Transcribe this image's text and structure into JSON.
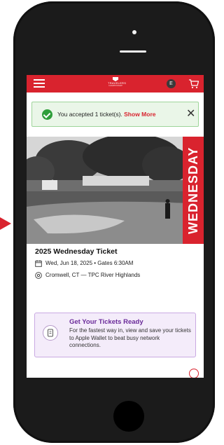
{
  "header": {
    "menu_icon": "hamburger-icon",
    "logo_text": "TRAVELERS",
    "logo_sub": "CHAMPIONSHIP",
    "avatar_text": "E",
    "cart_icon": "cart-icon"
  },
  "alert": {
    "message": "You accepted 1 ticket(s).",
    "show_more": "Show More",
    "close_symbol": "✕"
  },
  "ticket": {
    "day_banner": "WEDNESDAY",
    "title": "2025 Wednesday Ticket",
    "date_line": "Wed, Jun 18, 2025 • Gates 6:30AM",
    "location_line": "Cromwell, CT — TPC River Highlands"
  },
  "wallet_card": {
    "title": "Get Your Tickets Ready",
    "body": "For the fastest way in, view and save your tickets to Apple Wallet to beat busy network connections."
  },
  "colors": {
    "brand_red": "#d9232e",
    "success_green": "#2e9e3a",
    "card_purple": "#6a2a99"
  }
}
